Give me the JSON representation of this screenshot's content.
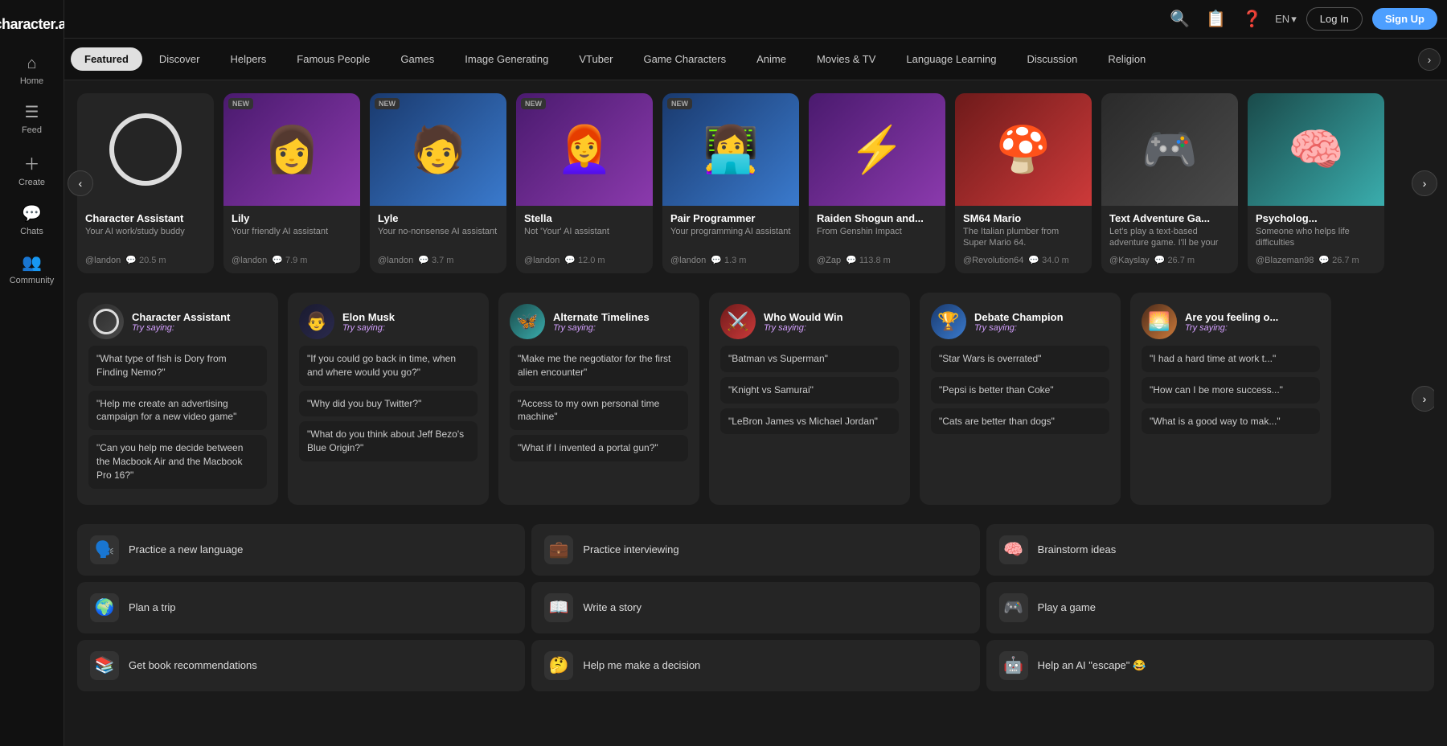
{
  "logo": "character.ai",
  "sidebar": {
    "items": [
      {
        "id": "home",
        "label": "Home",
        "icon": "⌂"
      },
      {
        "id": "feed",
        "label": "Feed",
        "icon": "≡"
      },
      {
        "id": "create",
        "label": "Create",
        "icon": "+"
      },
      {
        "id": "chats",
        "label": "Chats",
        "icon": "💬"
      },
      {
        "id": "community",
        "label": "Community",
        "icon": "👥"
      }
    ]
  },
  "topnav": {
    "lang": "EN",
    "login_label": "Log In",
    "signup_label": "Sign Up"
  },
  "tabs": {
    "items": [
      {
        "id": "featured",
        "label": "Featured",
        "active": true
      },
      {
        "id": "discover",
        "label": "Discover",
        "active": false
      },
      {
        "id": "helpers",
        "label": "Helpers",
        "active": false
      },
      {
        "id": "famous",
        "label": "Famous People",
        "active": false
      },
      {
        "id": "games",
        "label": "Games",
        "active": false
      },
      {
        "id": "image",
        "label": "Image Generating",
        "active": false
      },
      {
        "id": "vtuber",
        "label": "VTuber",
        "active": false
      },
      {
        "id": "game-chars",
        "label": "Game Characters",
        "active": false
      },
      {
        "id": "anime",
        "label": "Anime",
        "active": false
      },
      {
        "id": "movies",
        "label": "Movies & TV",
        "active": false
      },
      {
        "id": "lang-learn",
        "label": "Language Learning",
        "active": false
      },
      {
        "id": "discussion",
        "label": "Discussion",
        "active": false
      },
      {
        "id": "religion",
        "label": "Religion",
        "active": false
      }
    ]
  },
  "carousel": {
    "characters": [
      {
        "name": "Character Assistant",
        "desc": "Your AI work/study buddy",
        "author": "@landon",
        "chats": "20.5 m",
        "badge": "",
        "emoji": "⭕",
        "bg": "bg-gray"
      },
      {
        "name": "Lily",
        "desc": "Your friendly AI assistant",
        "author": "@landon",
        "chats": "7.9 m",
        "badge": "NEW",
        "emoji": "👩",
        "bg": "bg-purple"
      },
      {
        "name": "Lyle",
        "desc": "Your no-nonsense AI assistant",
        "author": "@landon",
        "chats": "3.7 m",
        "badge": "NEW",
        "emoji": "🧑",
        "bg": "bg-blue"
      },
      {
        "name": "Stella",
        "desc": "Not 'Your' AI assistant",
        "author": "@landon",
        "chats": "12.0 m",
        "badge": "NEW",
        "emoji": "👩‍🦰",
        "bg": "bg-purple"
      },
      {
        "name": "Pair Programmer",
        "desc": "Your programming AI assistant",
        "author": "@landon",
        "chats": "1.3 m",
        "badge": "NEW",
        "emoji": "👩‍💻",
        "bg": "bg-blue"
      },
      {
        "name": "Raiden Shogun and...",
        "desc": "From Genshin Impact",
        "author": "@Zap",
        "chats": "113.8 m",
        "badge": "",
        "emoji": "⚡",
        "bg": "bg-purple"
      },
      {
        "name": "SM64 Mario",
        "desc": "The Italian plumber from Super Mario 64.",
        "author": "@Revolution64",
        "chats": "34.0 m",
        "badge": "",
        "emoji": "🍄",
        "bg": "bg-red"
      },
      {
        "name": "Text Adventure Ga...",
        "desc": "Let's play a text-based adventure game. I'll be your guide. You are caug...",
        "author": "@Kayslay",
        "chats": "26.7 m",
        "badge": "",
        "emoji": "🎮",
        "bg": "bg-gray"
      },
      {
        "name": "Psycholog...",
        "desc": "Someone who helps life difficulties",
        "author": "@Blazeman98",
        "chats": "26.7 m",
        "badge": "",
        "emoji": "🧠",
        "bg": "bg-teal"
      }
    ]
  },
  "try_saying": {
    "title": "Try saying:",
    "cards": [
      {
        "name": "Character Assistant",
        "label": "Try saying:",
        "emoji": "⭕",
        "bg": "bg-gray",
        "prompts": [
          "\"What type of fish is Dory from Finding Nemo?\"",
          "\"Help me create an advertising campaign for a new video game\"",
          "\"Can you help me decide between the Macbook Air and the Macbook Pro 16?\""
        ]
      },
      {
        "name": "Elon Musk",
        "label": "Try saying:",
        "emoji": "👨",
        "bg": "bg-dark",
        "prompts": [
          "\"If you could go back in time, when and where would you go?\"",
          "\"Why did you buy Twitter?\"",
          "\"What do you think about Jeff Bezo's Blue Origin?\""
        ]
      },
      {
        "name": "Alternate Timelines",
        "label": "Try saying:",
        "emoji": "🦋",
        "bg": "bg-teal",
        "prompts": [
          "\"Make me the negotiator for the first alien encounter\"",
          "\"Access to my own personal time machine\"",
          "\"What if I invented a portal gun?\""
        ]
      },
      {
        "name": "Who Would Win",
        "label": "Try saying:",
        "emoji": "⚔️",
        "bg": "bg-red",
        "prompts": [
          "\"Batman vs Superman\"",
          "\"Knight vs Samurai\"",
          "\"LeBron James vs Michael Jordan\""
        ]
      },
      {
        "name": "Debate Champion",
        "label": "Try saying:",
        "emoji": "🏆",
        "bg": "bg-blue",
        "prompts": [
          "\"Star Wars is overrated\"",
          "\"Pepsi is better than Coke\"",
          "\"Cats are better than dogs\""
        ]
      },
      {
        "name": "Are you feeling o...",
        "label": "Try saying:",
        "emoji": "🌅",
        "bg": "bg-orange",
        "prompts": [
          "\"I had a hard time at work t...\"",
          "\"How can I be more success...\"",
          "\"What is a good way to mak...\""
        ]
      }
    ]
  },
  "quick_actions": [
    {
      "id": "practice-lang",
      "label": "Practice a new language",
      "emoji": "🗣️"
    },
    {
      "id": "practice-interview",
      "label": "Practice interviewing",
      "emoji": "💼"
    },
    {
      "id": "brainstorm",
      "label": "Brainstorm ideas",
      "emoji": "🧠"
    },
    {
      "id": "plan-trip",
      "label": "Plan a trip",
      "emoji": "🌍"
    },
    {
      "id": "write-story",
      "label": "Write a story",
      "emoji": "📖"
    },
    {
      "id": "play-game",
      "label": "Play a game",
      "emoji": "🎮"
    },
    {
      "id": "book-rec",
      "label": "Get book recommendations",
      "emoji": "📚"
    },
    {
      "id": "make-decision",
      "label": "Help me make a decision",
      "emoji": "🤔"
    },
    {
      "id": "ai-escape",
      "label": "Help an AI \"escape\" 😂",
      "emoji": "🤖"
    }
  ]
}
